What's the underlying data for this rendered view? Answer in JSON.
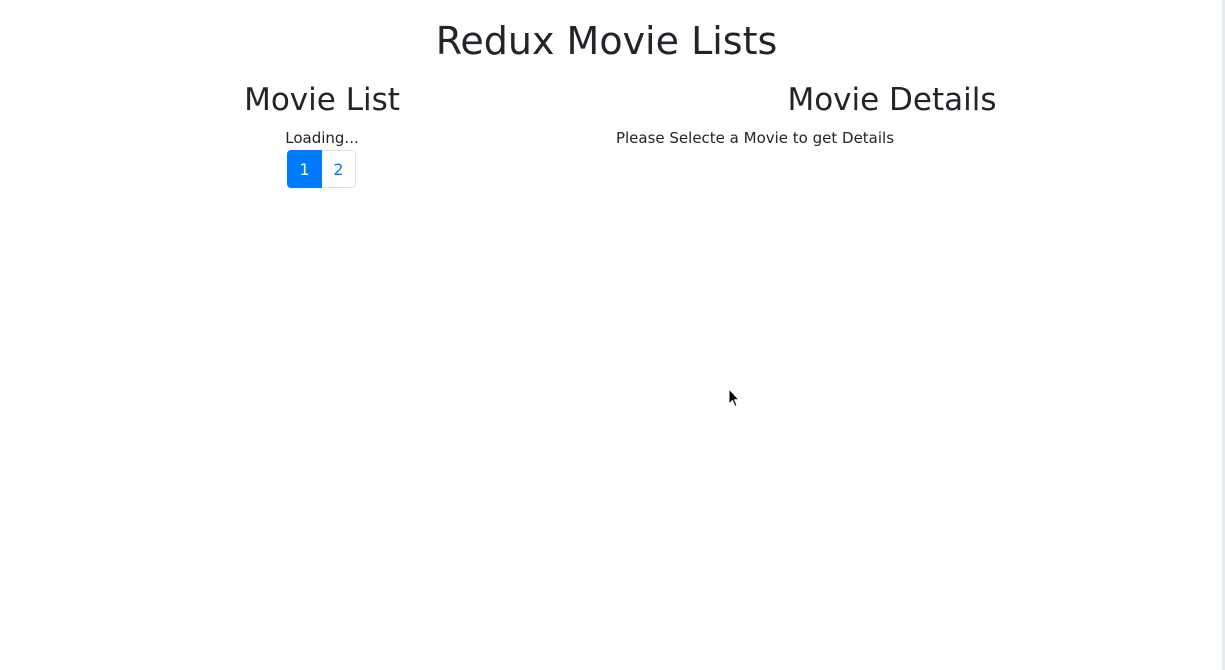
{
  "app": {
    "title": "Redux Movie Lists"
  },
  "movie_list": {
    "heading": "Movie List",
    "status": "Loading...",
    "pagination": {
      "pages": [
        "1",
        "2"
      ],
      "active_page": "1"
    }
  },
  "movie_details": {
    "heading": "Movie Details",
    "placeholder": "Please Selecte a Movie to get Details"
  },
  "colors": {
    "accent": "#007bff",
    "text": "#212529",
    "border": "#dee2e6"
  },
  "icons": {
    "cursor": "mouse-pointer-icon"
  }
}
